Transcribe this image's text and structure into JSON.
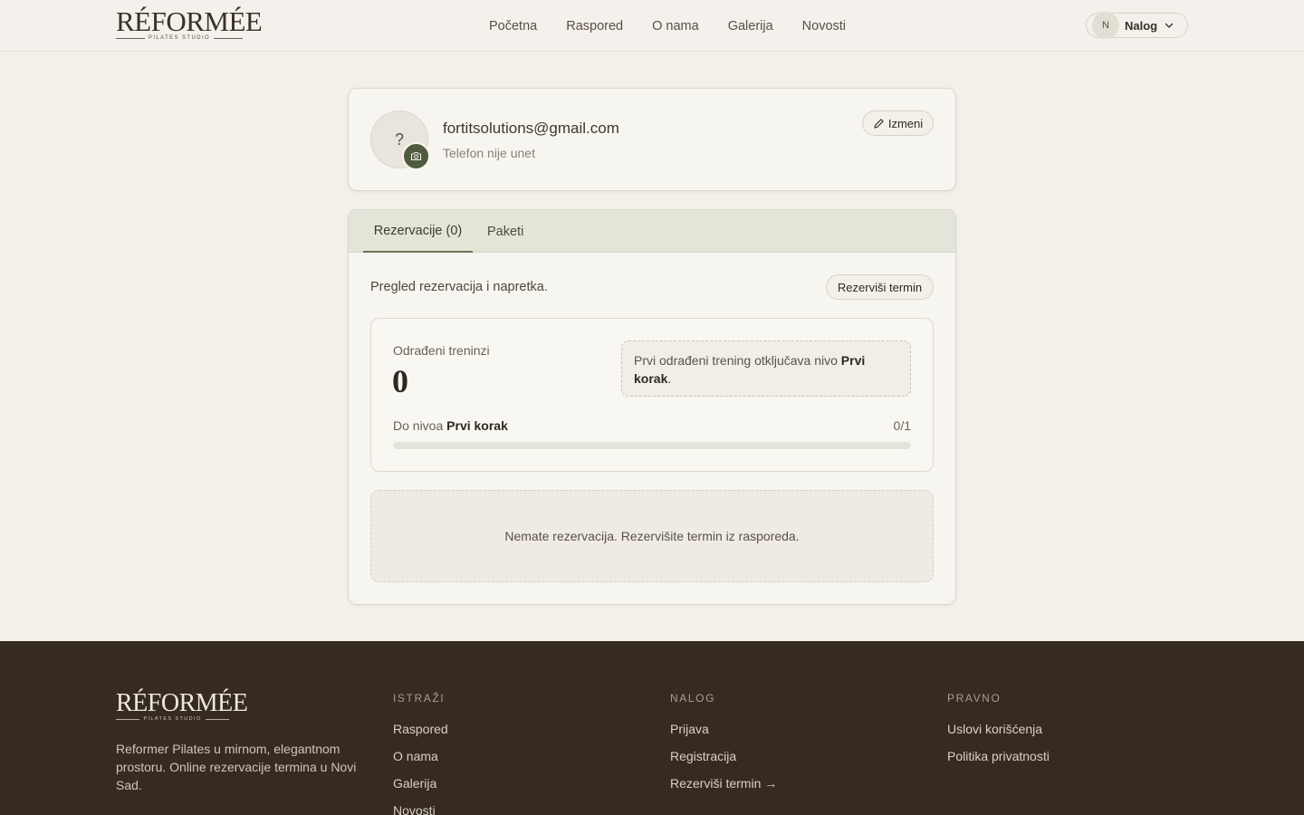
{
  "brand": {
    "name": "RÉFORMÉE",
    "tagline": "PILATES STUDIO"
  },
  "nav": {
    "items": [
      {
        "label": "Početna"
      },
      {
        "label": "Raspored"
      },
      {
        "label": "O nama"
      },
      {
        "label": "Galerija"
      },
      {
        "label": "Novosti"
      }
    ]
  },
  "account": {
    "initial": "N",
    "label": "Nalog"
  },
  "profile": {
    "avatar_placeholder": "?",
    "email": "fortitsolutions@gmail.com",
    "phone": "Telefon nije unet",
    "edit_label": "Izmeni"
  },
  "tabs": [
    {
      "label": "Rezervacije (0)",
      "active": true
    },
    {
      "label": "Paketi",
      "active": false
    }
  ],
  "reservations": {
    "overview": "Pregled rezervacija i napretka.",
    "book_label": "Rezerviši termin",
    "stats": {
      "label": "Odrađeni treninzi",
      "count": "0",
      "unlock_prefix": "Prvi odrađeni trening otključava nivo ",
      "unlock_level": "Prvi korak",
      "unlock_suffix": ".",
      "progress_prefix": "Do nivoa ",
      "progress_level": "Prvi korak",
      "progress_count": "0/1",
      "progress_fraction": 0
    },
    "empty_message": "Nemate rezervacija. Rezervišite termin iz rasporeda."
  },
  "footer": {
    "description": "Reformer Pilates u mirnom, elegantnom prostoru. Online rezervacije termina u Novi Sad.",
    "columns": [
      {
        "title": "ISTRAŽI",
        "links": [
          "Raspored",
          "O nama",
          "Galerija",
          "Novosti"
        ]
      },
      {
        "title": "NALOG",
        "links": [
          "Prijava",
          "Registracija",
          "Rezerviši termin →"
        ]
      },
      {
        "title": "PRAVNO",
        "links": [
          "Uslovi korišćenja",
          "Politika privatnosti"
        ]
      }
    ]
  },
  "colors": {
    "background": "#f3f0ea",
    "accent": "#6a7358",
    "camera_badge": "#4f5a3f",
    "footer": "#362b22"
  },
  "icons": [
    "camera-icon",
    "pencil-icon",
    "chevron-down-icon"
  ]
}
